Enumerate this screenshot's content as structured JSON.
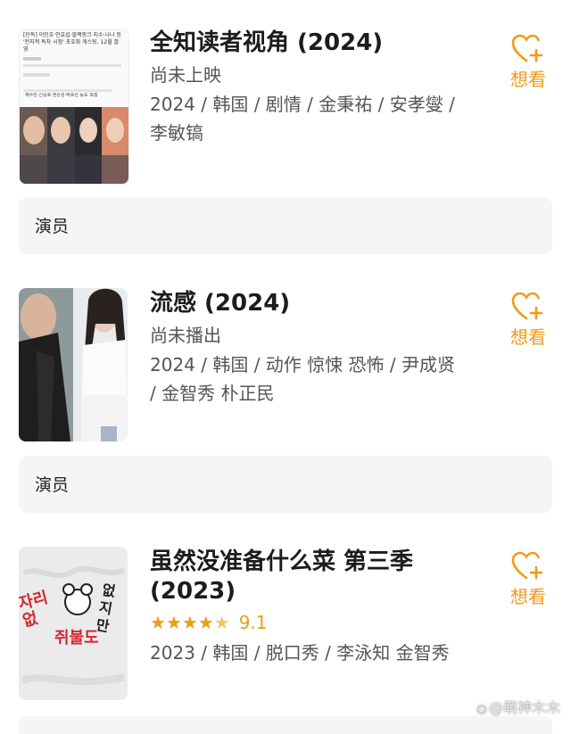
{
  "colors": {
    "accent": "#f09b17",
    "panel": "#f5f5f5",
    "text": "#1c1c1c",
    "muted": "#555555"
  },
  "items": [
    {
      "title": "全知读者视角 (2024)",
      "status": "尚未上映",
      "meta": "2024 / 韩国 / 剧情 / 金秉祐 / 安孝燮 / 李敏镐",
      "want_label": "想看",
      "actors_label": "演员",
      "poster": {
        "headline": "[단독] 이민호·안효섭·블랙핑크 지수·나나 등 '전지적 독자 시점' 초호화 캐스팅, 12월 촬영",
        "caption": "채수빈·신승호·권은성·박호산 등도 호흡"
      }
    },
    {
      "title": "流感 (2024)",
      "status": "尚未播出",
      "meta": "2024 / 韩国 / 动作 惊悚 恐怖 / 尹成贤 / 金智秀 朴正民",
      "want_label": "想看",
      "actors_label": "演员"
    },
    {
      "title": "虽然没准备什么菜 第三季 (2023)",
      "rating": {
        "stars": 4.5,
        "score": "9.1"
      },
      "meta": "2023 / 韩国 / 脱口秀 / 李泳知 金智秀",
      "want_label": "想看",
      "poster": {
        "text_left": "자리없",
        "text_mid": "쥐불도",
        "text_right": "없지 만"
      }
    }
  ],
  "watermark": "@萌神木木",
  "icons": {
    "want": "heart-plus-icon",
    "watermark": "weibo-icon"
  }
}
